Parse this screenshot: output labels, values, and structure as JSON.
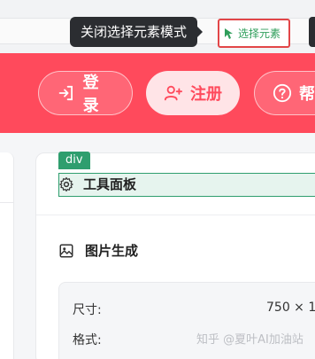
{
  "inspector": {
    "tooltip": "关闭选择元素模式",
    "select_button": "选择元素",
    "element_tag": "div"
  },
  "header": {
    "login_label": "登录",
    "register_label": "注册",
    "help_label": "帮"
  },
  "panel": {
    "tools_title": "工具面板",
    "generation_title": "图片生成",
    "size_label": "尺寸:",
    "size_value": "750 × 1",
    "format_label": "格式:"
  },
  "watermark": "知乎 @夏叶AI加油站",
  "colors": {
    "header_red": "#ff4a5c",
    "highlight_green": "#2f9e6e",
    "select_border": "#e24648"
  }
}
